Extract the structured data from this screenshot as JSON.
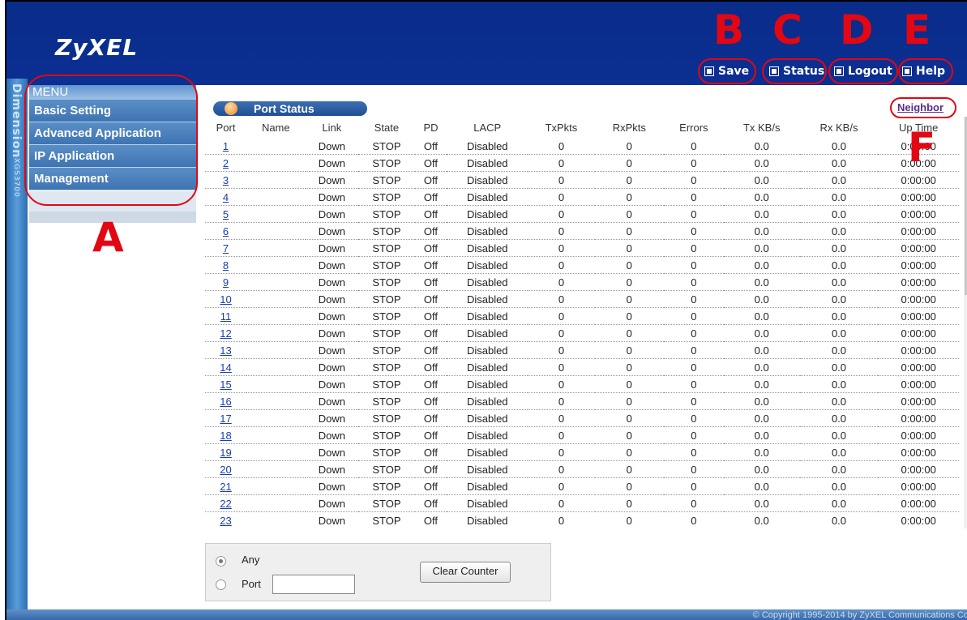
{
  "header": {
    "logo": "ZyXEL",
    "buttons": [
      {
        "label": "Save",
        "icon": "save-icon"
      },
      {
        "label": "Status",
        "icon": "status-icon"
      },
      {
        "label": "Logout",
        "icon": "logout-icon"
      },
      {
        "label": "Help",
        "icon": "help-icon"
      }
    ]
  },
  "side_strip": {
    "brand": "Dimension",
    "model": "XGS3700"
  },
  "menu": {
    "title": "MENU",
    "items": [
      "Basic Setting",
      "Advanced Application",
      "IP Application",
      "Management"
    ]
  },
  "callouts": {
    "A": "A",
    "B": "B",
    "C": "C",
    "D": "D",
    "E": "E",
    "F": "F"
  },
  "port_status": {
    "title": "Port Status",
    "neighbor_link": "Neighbor",
    "columns": [
      "Port",
      "Name",
      "Link",
      "State",
      "PD",
      "LACP",
      "TxPkts",
      "RxPkts",
      "Errors",
      "Tx KB/s",
      "Rx KB/s",
      "Up Time"
    ],
    "row_template": {
      "name": "",
      "link": "Down",
      "state": "STOP",
      "pd": "Off",
      "lacp": "Disabled",
      "txpkts": "0",
      "rxpkts": "0",
      "errors": "0",
      "tx": "0.0",
      "rx": "0.0",
      "uptime": "0:00:00"
    },
    "ports": [
      "1",
      "2",
      "3",
      "4",
      "5",
      "6",
      "7",
      "8",
      "9",
      "10",
      "11",
      "12",
      "13",
      "14",
      "15",
      "16",
      "17",
      "18",
      "19",
      "20",
      "21",
      "22",
      "23"
    ]
  },
  "counter_panel": {
    "any_label": "Any",
    "port_label": "Port",
    "port_value": "",
    "clear_button": "Clear Counter",
    "selected": "any"
  },
  "footer": {
    "copyright": "© Copyright 1995-2014 by ZyXEL Communications Co"
  },
  "colors": {
    "header": "#0b2f92",
    "annotation": "#e30613",
    "menu": "#4a80bd",
    "link": "#1a3fb0"
  }
}
